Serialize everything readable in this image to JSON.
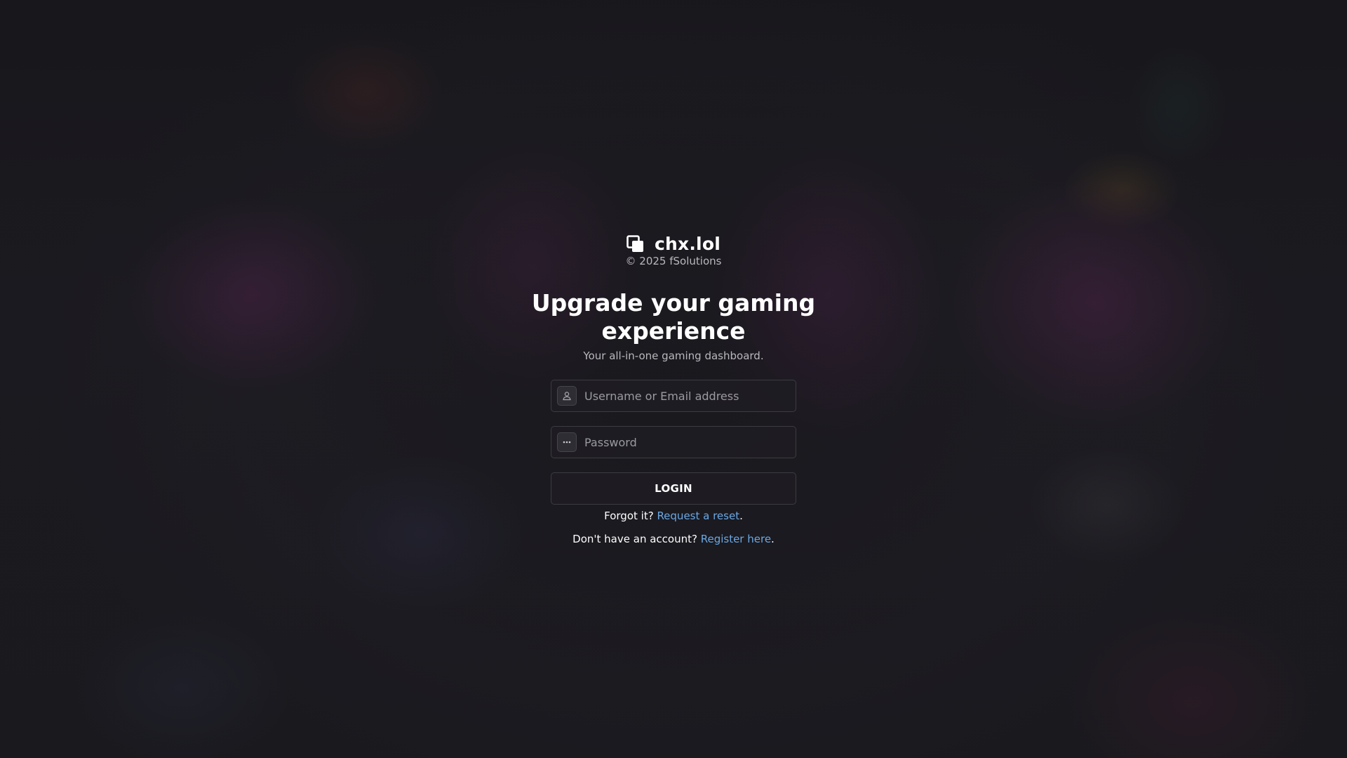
{
  "brand": {
    "name": "chx.lol",
    "copyright": "© 2025 fSolutions"
  },
  "hero": {
    "headline_line1": "Upgrade your gaming",
    "headline_line2": "experience",
    "tagline": "Your all-in-one gaming dashboard."
  },
  "form": {
    "username_placeholder": "Username or Email address",
    "username_icon": "user-icon",
    "password_placeholder": "Password",
    "password_icon": "dots-icon",
    "login_label": "LOGIN"
  },
  "links": {
    "forgot_prefix": "Forgot it? ",
    "forgot_link": "Request a reset",
    "forgot_suffix": ".",
    "register_prefix": "Don't have an account? ",
    "register_link": "Register here",
    "register_suffix": "."
  },
  "colors": {
    "link": "#6aa8e4",
    "background": "#1d1c21",
    "border": "#3c3b42"
  }
}
